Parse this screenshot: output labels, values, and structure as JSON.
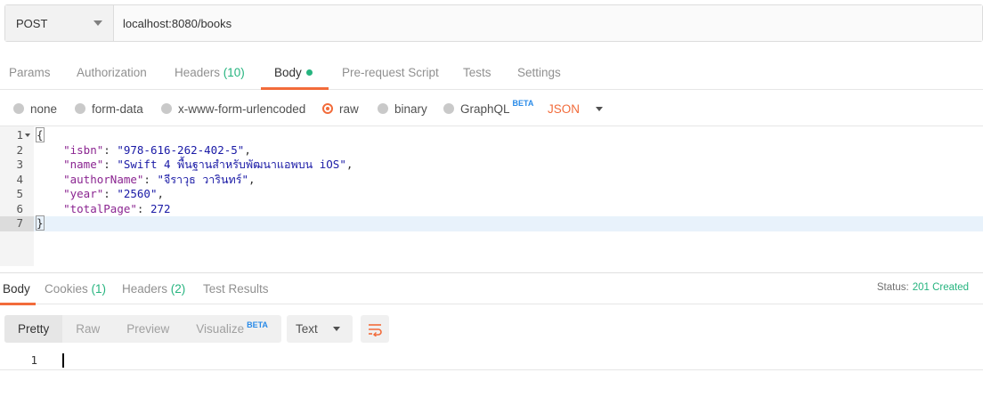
{
  "request": {
    "method": "POST",
    "url": "localhost:8080/books"
  },
  "req_tabs": {
    "params": "Params",
    "authorization": "Authorization",
    "headers_label": "Headers",
    "headers_count": "(10)",
    "body": "Body",
    "prerequest": "Pre-request Script",
    "tests": "Tests",
    "settings": "Settings"
  },
  "body_types": {
    "none": "none",
    "form_data": "form-data",
    "urlencoded": "x-www-form-urlencoded",
    "raw": "raw",
    "binary": "binary",
    "graphql": "GraphQL",
    "beta": "BETA",
    "format": "JSON"
  },
  "editor": {
    "line_numbers": [
      "1",
      "2",
      "3",
      "4",
      "5",
      "6",
      "7"
    ],
    "open_brace": "{",
    "close_brace": "}",
    "fields": [
      {
        "key": "\"isbn\"",
        "value": "\"978-616-262-402-5\"",
        "tail": ","
      },
      {
        "key": "\"name\"",
        "value": "\"Swift 4 พื้นฐานสำหรับพัฒนาแอพบน iOS\"",
        "tail": ","
      },
      {
        "key": "\"authorName\"",
        "value": "\"จีราวุธ วารินทร์\"",
        "tail": ","
      },
      {
        "key": "\"year\"",
        "value": "\"2560\"",
        "tail": ","
      },
      {
        "key": "\"totalPage\"",
        "value": "272",
        "tail": ""
      }
    ]
  },
  "resp_tabs": {
    "body": "Body",
    "cookies_label": "Cookies",
    "cookies_count": "(1)",
    "headers_label": "Headers",
    "headers_count": "(2)",
    "test_results": "Test Results",
    "status_label": "Status:",
    "status_value": "201 Created"
  },
  "view": {
    "pretty": "Pretty",
    "raw": "Raw",
    "preview": "Preview",
    "visualize": "Visualize",
    "beta": "BETA",
    "format": "Text",
    "wrap_icon": "wrap-lines-icon"
  },
  "response": {
    "line_number": "1"
  },
  "colors": {
    "accent": "#f26b3a",
    "success": "#26b47f",
    "beta": "#2a8be8"
  }
}
